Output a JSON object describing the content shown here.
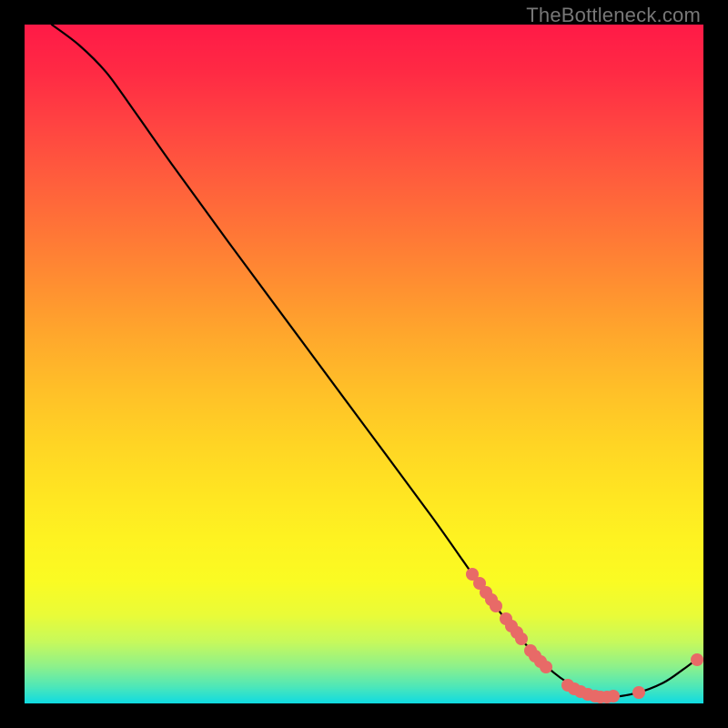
{
  "watermark": "TheBottleneck.com",
  "chart_data": {
    "type": "line",
    "title": "",
    "xlabel": "",
    "ylabel": "",
    "xlim": [
      0,
      100
    ],
    "ylim": [
      0,
      100
    ],
    "background": "heatmap-gradient-red-to-cyan",
    "series": [
      {
        "name": "curve",
        "points_xy": [
          [
            4,
            100
          ],
          [
            8,
            97
          ],
          [
            12,
            93
          ],
          [
            16,
            87.5
          ],
          [
            22,
            79
          ],
          [
            30,
            68
          ],
          [
            40,
            54.5
          ],
          [
            50,
            41
          ],
          [
            60,
            27.5
          ],
          [
            66,
            19
          ],
          [
            70,
            13.5
          ],
          [
            74,
            8.5
          ],
          [
            78,
            4.5
          ],
          [
            82,
            2
          ],
          [
            86,
            1
          ],
          [
            90,
            1.5
          ],
          [
            94,
            3
          ],
          [
            97,
            5
          ],
          [
            99,
            6.5
          ]
        ]
      }
    ],
    "markers": [
      {
        "x": 66.0,
        "y": 19.0
      },
      {
        "x": 67.0,
        "y": 17.7
      },
      {
        "x": 68.0,
        "y": 16.4
      },
      {
        "x": 68.8,
        "y": 15.3
      },
      {
        "x": 69.5,
        "y": 14.3
      },
      {
        "x": 70.9,
        "y": 12.5
      },
      {
        "x": 71.7,
        "y": 11.4
      },
      {
        "x": 72.5,
        "y": 10.4
      },
      {
        "x": 73.2,
        "y": 9.5
      },
      {
        "x": 74.5,
        "y": 7.8
      },
      {
        "x": 75.2,
        "y": 7.0
      },
      {
        "x": 76.0,
        "y": 6.1
      },
      {
        "x": 76.8,
        "y": 5.3
      },
      {
        "x": 80.0,
        "y": 2.7
      },
      {
        "x": 81.0,
        "y": 2.1
      },
      {
        "x": 81.9,
        "y": 1.7
      },
      {
        "x": 83.0,
        "y": 1.3
      },
      {
        "x": 84.0,
        "y": 1.1
      },
      {
        "x": 84.9,
        "y": 1.0
      },
      {
        "x": 85.8,
        "y": 1.0
      },
      {
        "x": 86.7,
        "y": 1.1
      },
      {
        "x": 90.5,
        "y": 1.6
      },
      {
        "x": 99.0,
        "y": 6.5
      }
    ]
  }
}
